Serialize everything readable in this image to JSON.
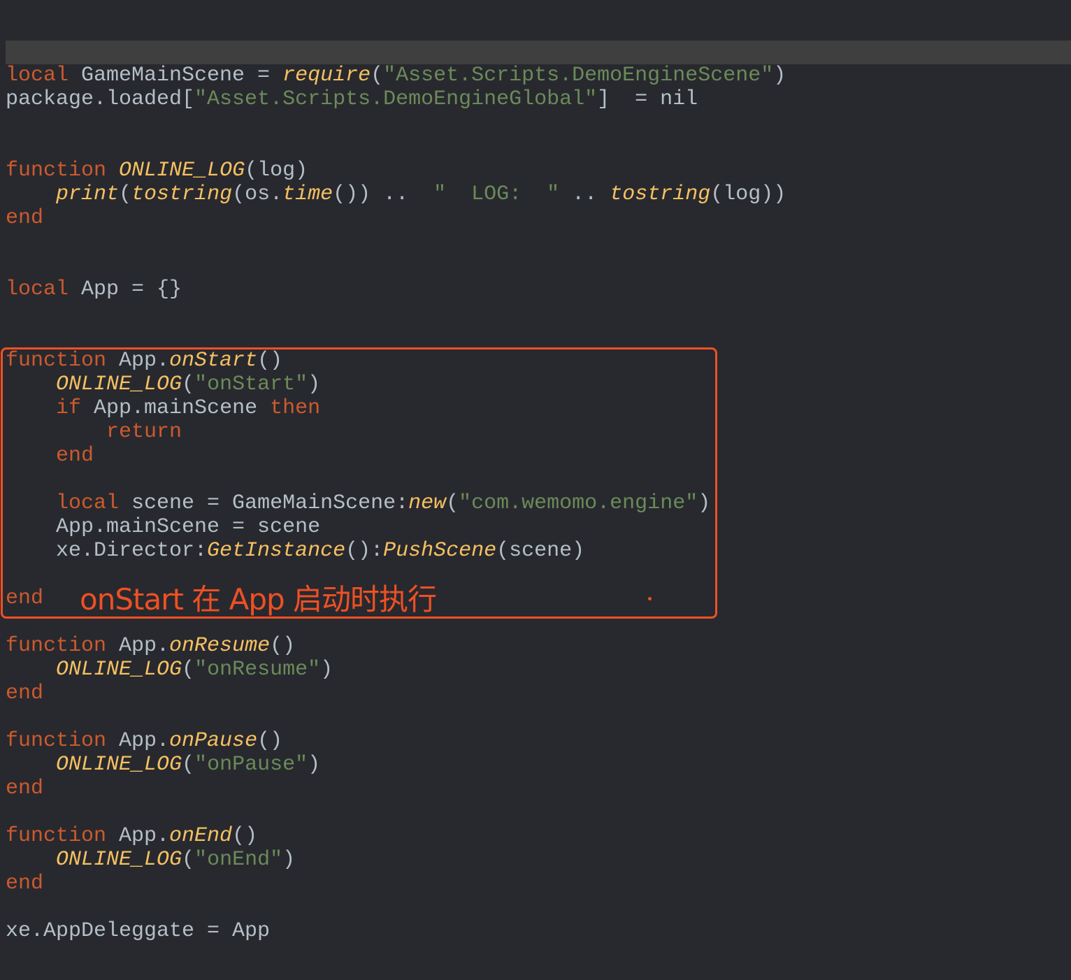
{
  "colors": {
    "background": "#28292e",
    "keyword": "#cc5a2e",
    "function": "#f6c062",
    "string": "#6b8a5a",
    "text": "#b4bfc8",
    "annotation": "#ef5024"
  },
  "annotation": {
    "text": "onStart 在 App 启动时执行"
  },
  "code": {
    "lines": [
      [
        [
          "kw",
          "local"
        ],
        [
          "plain",
          " GameMainScene = "
        ],
        [
          "fn",
          "require"
        ],
        [
          "plain",
          "("
        ],
        [
          "str",
          "\"Asset.Scripts.DemoEngineScene\""
        ],
        [
          "plain",
          ")"
        ]
      ],
      [
        [
          "plain",
          "package.loaded["
        ],
        [
          "str",
          "\"Asset.Scripts.DemoEngineGlobal\""
        ],
        [
          "plain",
          "]  = nil"
        ]
      ],
      [],
      [],
      [
        [
          "kw",
          "function"
        ],
        [
          "plain",
          " "
        ],
        [
          "fn",
          "ONLINE_LOG"
        ],
        [
          "plain",
          "(log)"
        ]
      ],
      [
        [
          "plain",
          "    "
        ],
        [
          "fn",
          "print"
        ],
        [
          "plain",
          "("
        ],
        [
          "fn",
          "tostring"
        ],
        [
          "plain",
          "(os."
        ],
        [
          "fn",
          "time"
        ],
        [
          "plain",
          "()) ..  "
        ],
        [
          "str",
          "\"  LOG:  \""
        ],
        [
          "plain",
          " .. "
        ],
        [
          "fn",
          "tostring"
        ],
        [
          "plain",
          "(log))"
        ]
      ],
      [
        [
          "kw",
          "end"
        ]
      ],
      [],
      [],
      [
        [
          "kw",
          "local"
        ],
        [
          "plain",
          " App = {}"
        ]
      ],
      [],
      [],
      [
        [
          "kw",
          "function"
        ],
        [
          "plain",
          " App."
        ],
        [
          "fn",
          "onStart"
        ],
        [
          "plain",
          "()"
        ]
      ],
      [
        [
          "plain",
          "    "
        ],
        [
          "fn",
          "ONLINE_LOG"
        ],
        [
          "plain",
          "("
        ],
        [
          "str",
          "\"onStart\""
        ],
        [
          "plain",
          ")"
        ]
      ],
      [
        [
          "plain",
          "    "
        ],
        [
          "kw",
          "if"
        ],
        [
          "plain",
          " App.mainScene "
        ],
        [
          "kw",
          "then"
        ]
      ],
      [
        [
          "plain",
          "        "
        ],
        [
          "kw",
          "return"
        ]
      ],
      [
        [
          "plain",
          "    "
        ],
        [
          "kw",
          "end"
        ]
      ],
      [],
      [
        [
          "plain",
          "    "
        ],
        [
          "kw",
          "local"
        ],
        [
          "plain",
          " scene = GameMainScene:"
        ],
        [
          "fn",
          "new"
        ],
        [
          "plain",
          "("
        ],
        [
          "str",
          "\"com.wemomo.engine\""
        ],
        [
          "plain",
          ")"
        ]
      ],
      [
        [
          "plain",
          "    App.mainScene = scene"
        ]
      ],
      [
        [
          "plain",
          "    xe.Director:"
        ],
        [
          "fn",
          "GetInstance"
        ],
        [
          "plain",
          "():"
        ],
        [
          "fn",
          "PushScene"
        ],
        [
          "plain",
          "(scene)"
        ]
      ],
      [],
      [
        [
          "kw",
          "end"
        ]
      ],
      [],
      [
        [
          "kw",
          "function"
        ],
        [
          "plain",
          " App."
        ],
        [
          "fn",
          "onResume"
        ],
        [
          "plain",
          "()"
        ]
      ],
      [
        [
          "plain",
          "    "
        ],
        [
          "fn",
          "ONLINE_LOG"
        ],
        [
          "plain",
          "("
        ],
        [
          "str",
          "\"onResume\""
        ],
        [
          "plain",
          ")"
        ]
      ],
      [
        [
          "kw",
          "end"
        ]
      ],
      [],
      [
        [
          "kw",
          "function"
        ],
        [
          "plain",
          " App."
        ],
        [
          "fn",
          "onPause"
        ],
        [
          "plain",
          "()"
        ]
      ],
      [
        [
          "plain",
          "    "
        ],
        [
          "fn",
          "ONLINE_LOG"
        ],
        [
          "plain",
          "("
        ],
        [
          "str",
          "\"onPause\""
        ],
        [
          "plain",
          ")"
        ]
      ],
      [
        [
          "kw",
          "end"
        ]
      ],
      [],
      [
        [
          "kw",
          "function"
        ],
        [
          "plain",
          " App."
        ],
        [
          "fn",
          "onEnd"
        ],
        [
          "plain",
          "()"
        ]
      ],
      [
        [
          "plain",
          "    "
        ],
        [
          "fn",
          "ONLINE_LOG"
        ],
        [
          "plain",
          "("
        ],
        [
          "str",
          "\"onEnd\""
        ],
        [
          "plain",
          ")"
        ]
      ],
      [
        [
          "kw",
          "end"
        ]
      ],
      [],
      [
        [
          "plain",
          "xe.AppDeleggate = App"
        ]
      ]
    ]
  }
}
